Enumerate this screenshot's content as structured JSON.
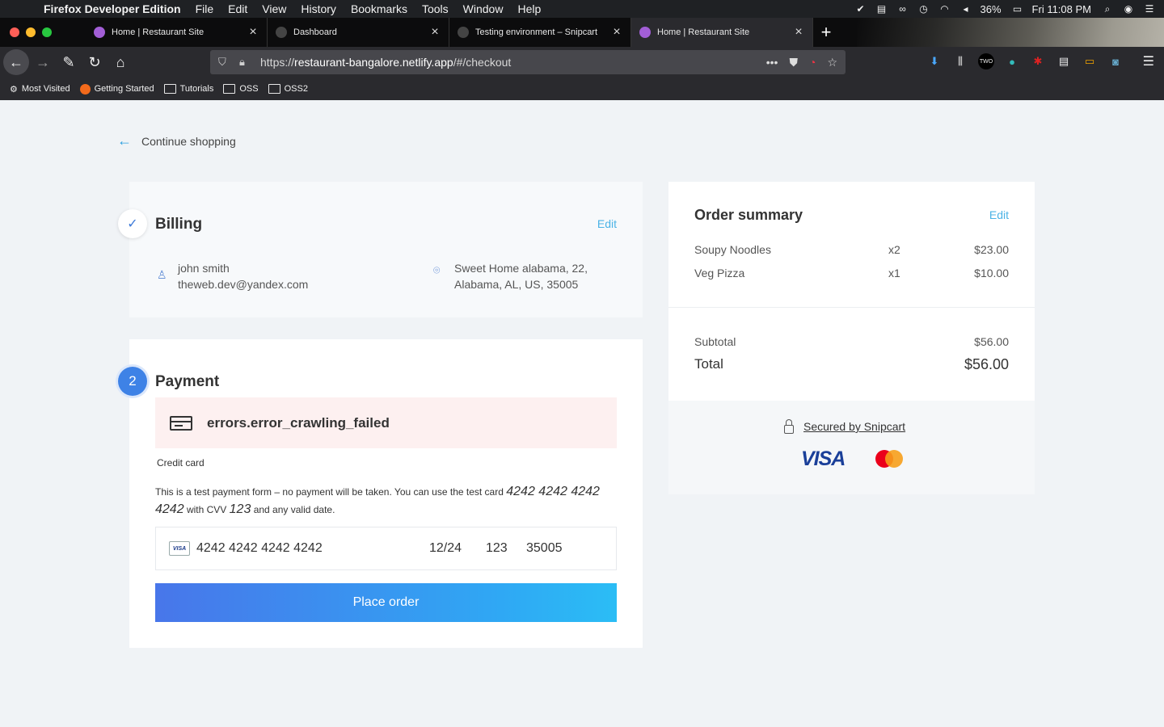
{
  "menubar": {
    "app_name": "Firefox Developer Edition",
    "items": [
      "File",
      "Edit",
      "View",
      "History",
      "Bookmarks",
      "Tools",
      "Window",
      "Help"
    ],
    "battery": "36%",
    "clock": "Fri 11:08 PM"
  },
  "tabs": [
    {
      "label": "Home | Restaurant Site",
      "active": false
    },
    {
      "label": "Dashboard",
      "active": false
    },
    {
      "label": "Testing environment – Snipcart",
      "active": false
    },
    {
      "label": "Home | Restaurant Site",
      "active": true
    }
  ],
  "urlbar": {
    "prefix": "https://",
    "host": "restaurant-bangalore.netlify.app",
    "path": "/#/checkout"
  },
  "bookmarks": [
    "Most Visited",
    "Getting Started",
    "Tutorials",
    "OSS",
    "OSS2"
  ],
  "page": {
    "continue_label": "Continue shopping",
    "billing": {
      "title": "Billing",
      "edit": "Edit",
      "name": "john smith",
      "email": "theweb.dev@yandex.com",
      "address_line1": "Sweet Home alabama, 22,",
      "address_line2": "Alabama, AL, US, 35005"
    },
    "payment": {
      "step": "2",
      "title": "Payment",
      "error": "errors.error_crawling_failed",
      "cc_label": "Credit card",
      "note_pre": "This is a test payment form – no payment will be taken. You can use the test card",
      "note_card": "4242 4242 4242 4242",
      "note_mid": "with CVV",
      "note_cvv": "123",
      "note_post": "and any valid date.",
      "card_number": "4242 4242 4242 4242",
      "expiry": "12/24",
      "cvv": "123",
      "zip": "35005",
      "place_order": "Place order"
    },
    "summary": {
      "title": "Order summary",
      "edit": "Edit",
      "items": [
        {
          "name": "Soupy Noodles",
          "qty": "x2",
          "price": "$23.00"
        },
        {
          "name": "Veg Pizza",
          "qty": "x1",
          "price": "$10.00"
        }
      ],
      "subtotal_label": "Subtotal",
      "subtotal_value": "$56.00",
      "total_label": "Total",
      "total_value": "$56.00",
      "secured": "Secured by Snipcart",
      "visa_text": "VISA"
    }
  },
  "colors": {
    "accent": "#4bb3e6",
    "primary_button_start": "#4876ea",
    "primary_button_end": "#2bbdf5",
    "error_bg": "#fdf0f0"
  }
}
